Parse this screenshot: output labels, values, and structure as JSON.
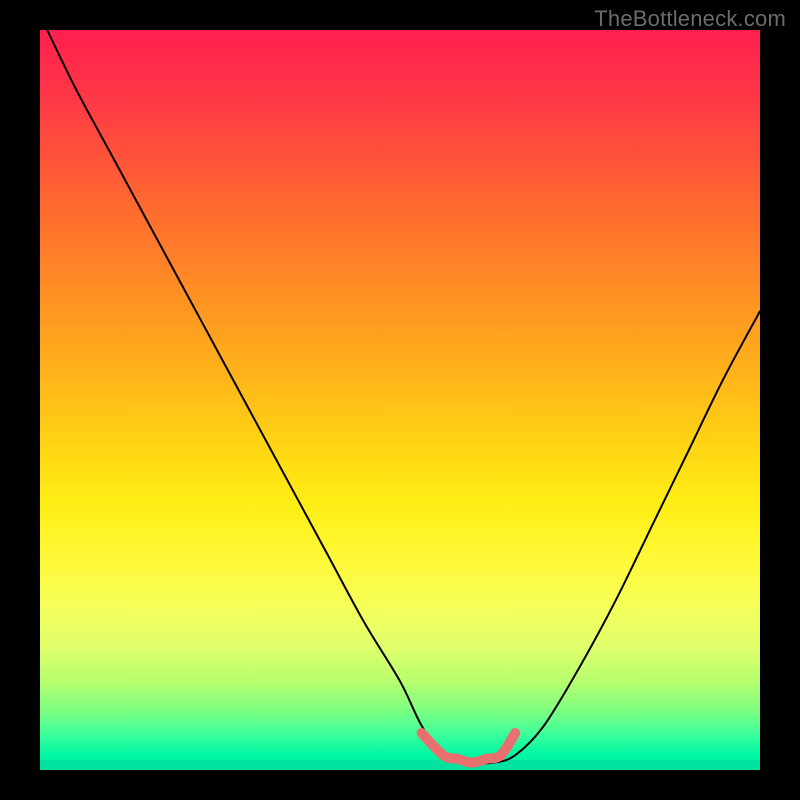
{
  "watermark": "TheBottleneck.com",
  "chart_data": {
    "type": "line",
    "title": "",
    "xlabel": "",
    "ylabel": "",
    "xlim": [
      0,
      100
    ],
    "ylim": [
      0,
      100
    ],
    "background_gradient": {
      "direction": "vertical",
      "stops": [
        {
          "pos": 0,
          "color": "#ff1f4f"
        },
        {
          "pos": 24,
          "color": "#ff6a2f"
        },
        {
          "pos": 46,
          "color": "#ffb11a"
        },
        {
          "pos": 64,
          "color": "#ffee15"
        },
        {
          "pos": 83,
          "color": "#e2ff6a"
        },
        {
          "pos": 95,
          "color": "#3fff9a"
        },
        {
          "pos": 100,
          "color": "#00e29f"
        }
      ]
    },
    "series": [
      {
        "name": "bottleneck-curve",
        "color": "#000000",
        "x": [
          1,
          5,
          10,
          15,
          20,
          25,
          30,
          35,
          40,
          45,
          50,
          53,
          56,
          60,
          63,
          66,
          70,
          75,
          80,
          85,
          90,
          95,
          100
        ],
        "y": [
          100,
          92,
          83,
          74,
          65,
          56,
          47,
          38,
          29,
          20,
          12,
          6,
          2,
          1,
          1,
          2,
          6,
          14,
          23,
          33,
          43,
          53,
          62
        ]
      },
      {
        "name": "optimal-zone-marker",
        "color": "#e8716f",
        "x": [
          53,
          56,
          58,
          60,
          62,
          64,
          66
        ],
        "y": [
          5,
          2,
          1.5,
          1,
          1.5,
          2,
          5
        ]
      }
    ],
    "annotations": []
  }
}
